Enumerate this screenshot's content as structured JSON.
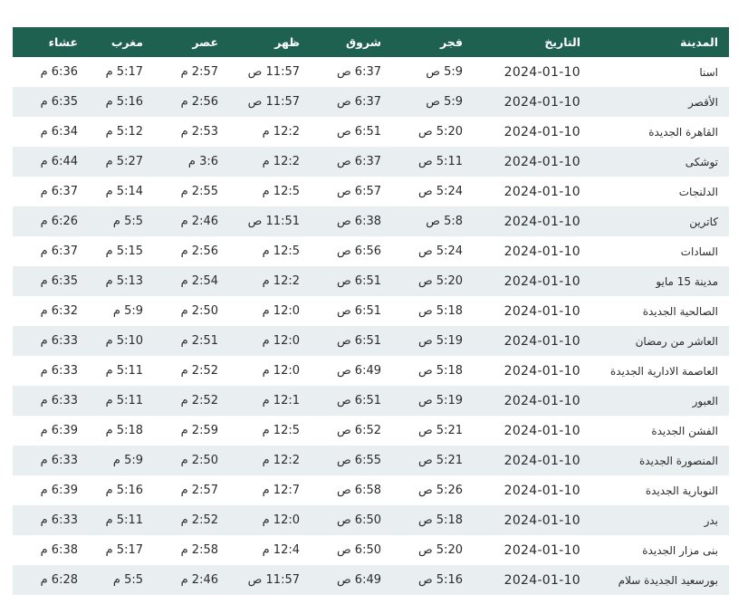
{
  "headers": {
    "city": "المدينة",
    "date": "التاريخ",
    "fajr": "فجر",
    "shorouk": "شروق",
    "dhuhr": "ظهر",
    "asr": "عصر",
    "maghrib": "مغرب",
    "isha": "عشاء"
  },
  "rows": [
    {
      "city": "اسنا",
      "date": "2024-01-10",
      "fajr": "5:9 ص",
      "shorouk": "6:37 ص",
      "dhuhr": "11:57 ص",
      "asr": "2:57 م",
      "maghrib": "5:17 م",
      "isha": "6:36 م"
    },
    {
      "city": "الأقصر",
      "date": "2024-01-10",
      "fajr": "5:9 ص",
      "shorouk": "6:37 ص",
      "dhuhr": "11:57 ص",
      "asr": "2:56 م",
      "maghrib": "5:16 م",
      "isha": "6:35 م"
    },
    {
      "city": "القاهرة الجديدة",
      "date": "2024-01-10",
      "fajr": "5:20 ص",
      "shorouk": "6:51 ص",
      "dhuhr": "12:2 م",
      "asr": "2:53 م",
      "maghrib": "5:12 م",
      "isha": "6:34 م"
    },
    {
      "city": "توشكى",
      "date": "2024-01-10",
      "fajr": "5:11 ص",
      "shorouk": "6:37 ص",
      "dhuhr": "12:2 م",
      "asr": "3:6 م",
      "maghrib": "5:27 م",
      "isha": "6:44 م"
    },
    {
      "city": "الدلنجات",
      "date": "2024-01-10",
      "fajr": "5:24 ص",
      "shorouk": "6:57 ص",
      "dhuhr": "12:5 م",
      "asr": "2:55 م",
      "maghrib": "5:14 م",
      "isha": "6:37 م"
    },
    {
      "city": "كاترين",
      "date": "2024-01-10",
      "fajr": "5:8 ص",
      "shorouk": "6:38 ص",
      "dhuhr": "11:51 ص",
      "asr": "2:46 م",
      "maghrib": "5:5 م",
      "isha": "6:26 م"
    },
    {
      "city": "السادات",
      "date": "2024-01-10",
      "fajr": "5:24 ص",
      "shorouk": "6:56 ص",
      "dhuhr": "12:5 م",
      "asr": "2:56 م",
      "maghrib": "5:15 م",
      "isha": "6:37 م"
    },
    {
      "city": "مدينة 15 مايو",
      "date": "2024-01-10",
      "fajr": "5:20 ص",
      "shorouk": "6:51 ص",
      "dhuhr": "12:2 م",
      "asr": "2:54 م",
      "maghrib": "5:13 م",
      "isha": "6:35 م"
    },
    {
      "city": "الصالحية الجديدة",
      "date": "2024-01-10",
      "fajr": "5:18 ص",
      "shorouk": "6:51 ص",
      "dhuhr": "12:0 م",
      "asr": "2:50 م",
      "maghrib": "5:9 م",
      "isha": "6:32 م"
    },
    {
      "city": "العاشر من رمضان",
      "date": "2024-01-10",
      "fajr": "5:19 ص",
      "shorouk": "6:51 ص",
      "dhuhr": "12:0 م",
      "asr": "2:51 م",
      "maghrib": "5:10 م",
      "isha": "6:33 م"
    },
    {
      "city": "العاصمة الادارية الجديدة",
      "date": "2024-01-10",
      "fajr": "5:18 ص",
      "shorouk": "6:49 ص",
      "dhuhr": "12:0 م",
      "asr": "2:52 م",
      "maghrib": "5:11 م",
      "isha": "6:33 م"
    },
    {
      "city": "العبور",
      "date": "2024-01-10",
      "fajr": "5:19 ص",
      "shorouk": "6:51 ص",
      "dhuhr": "12:1 م",
      "asr": "2:52 م",
      "maghrib": "5:11 م",
      "isha": "6:33 م"
    },
    {
      "city": "الفشن الجديدة",
      "date": "2024-01-10",
      "fajr": "5:21 ص",
      "shorouk": "6:52 ص",
      "dhuhr": "12:5 م",
      "asr": "2:59 م",
      "maghrib": "5:18 م",
      "isha": "6:39 م"
    },
    {
      "city": "المنصورة الجديدة",
      "date": "2024-01-10",
      "fajr": "5:21 ص",
      "shorouk": "6:55 ص",
      "dhuhr": "12:2 م",
      "asr": "2:50 م",
      "maghrib": "5:9 م",
      "isha": "6:33 م"
    },
    {
      "city": "النوبارية الجديدة",
      "date": "2024-01-10",
      "fajr": "5:26 ص",
      "shorouk": "6:58 ص",
      "dhuhr": "12:7 م",
      "asr": "2:57 م",
      "maghrib": "5:16 م",
      "isha": "6:39 م"
    },
    {
      "city": "بدر",
      "date": "2024-01-10",
      "fajr": "5:18 ص",
      "shorouk": "6:50 ص",
      "dhuhr": "12:0 م",
      "asr": "2:52 م",
      "maghrib": "5:11 م",
      "isha": "6:33 م"
    },
    {
      "city": "بنى مزار الجديدة",
      "date": "2024-01-10",
      "fajr": "5:20 ص",
      "shorouk": "6:50 ص",
      "dhuhr": "12:4 م",
      "asr": "2:58 م",
      "maghrib": "5:17 م",
      "isha": "6:38 م"
    },
    {
      "city": "بورسعيد الجديدة سلام",
      "date": "2024-01-10",
      "fajr": "5:16 ص",
      "shorouk": "6:49 ص",
      "dhuhr": "11:57 ص",
      "asr": "2:46 م",
      "maghrib": "5:5 م",
      "isha": "6:28 م"
    }
  ]
}
